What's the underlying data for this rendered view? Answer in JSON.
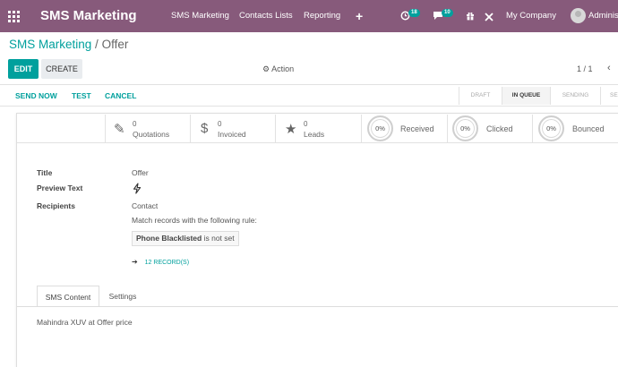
{
  "navbar": {
    "app_name": "SMS Marketing",
    "menu": [
      "SMS Marketing",
      "Contacts Lists",
      "Reporting"
    ],
    "plus": "+",
    "activity_count": "18",
    "message_count": "10",
    "company": "My Company",
    "user": "Administrator"
  },
  "breadcrumb": {
    "parent": "SMS Marketing",
    "separator": "/",
    "current": "Offer"
  },
  "toolbar": {
    "edit": "EDIT",
    "create": "CREATE",
    "action": "Action",
    "pager": "1 / 1"
  },
  "statusbar": {
    "buttons": [
      "SEND NOW",
      "TEST",
      "CANCEL"
    ],
    "stages": [
      "DRAFT",
      "IN QUEUE",
      "SENDING",
      "SENT"
    ],
    "active_stage": "IN QUEUE"
  },
  "stats": {
    "quotations": {
      "value": "0",
      "label": "Quotations"
    },
    "invoiced": {
      "value": "0",
      "label": "Invoiced"
    },
    "leads": {
      "value": "0",
      "label": "Leads"
    },
    "received": {
      "pct": "0%",
      "label": "Received"
    },
    "clicked": {
      "pct": "0%",
      "label": "Clicked"
    },
    "bounced": {
      "pct": "0%",
      "label": "Bounced"
    }
  },
  "form": {
    "title_label": "Title",
    "title_value": "Offer",
    "preview_label": "Preview Text",
    "recipients_label": "Recipients",
    "recipients_value": "Contact",
    "rule_intro": "Match records with the following rule:",
    "rule_field": "Phone Blacklisted",
    "rule_op": "is not set",
    "records_link": "12 RECORD(S)"
  },
  "tabs": [
    "SMS Content",
    "Settings"
  ],
  "sms_content": "Mahindra XUV at Offer price",
  "colors": {
    "brand": "#875a7b",
    "accent": "#00a09d"
  }
}
